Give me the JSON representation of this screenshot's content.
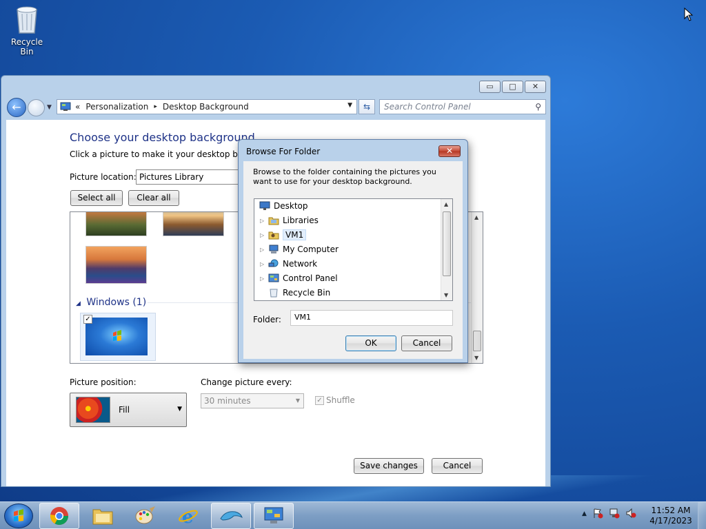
{
  "desktop": {
    "icons": [
      {
        "label": "Recycle Bin",
        "icon": "recycle-bin-icon"
      }
    ]
  },
  "window": {
    "caption_buttons": {
      "minimize": "▭",
      "maximize": "□",
      "close": "✕"
    },
    "address": {
      "prefix": "«",
      "crumbs": [
        "Personalization",
        "Desktop Background"
      ],
      "separator": "▸",
      "dropdown": "▼",
      "refresh": "⇆"
    },
    "search": {
      "placeholder": "Search Control Panel",
      "icon": "⚲"
    },
    "heading": "Choose your desktop background",
    "subheading": "Click a picture to make it your desktop background",
    "picture_location_label": "Picture location:",
    "picture_location_value": "Pictures Library",
    "select_all": "Select all",
    "clear_all": "Clear all",
    "group_expander": "◢",
    "group_title": "Windows (1)",
    "checkmark": "✓",
    "scroll_up": "▲",
    "scroll_down": "▼",
    "picture_position_label": "Picture position:",
    "picture_position_value": "Fill",
    "change_every_label": "Change picture every:",
    "change_every_value": "30 minutes",
    "shuffle_label": "Shuffle",
    "shuffle_checked": true,
    "save_changes": "Save changes",
    "cancel": "Cancel"
  },
  "dialog": {
    "title": "Browse For Folder",
    "close": "✕",
    "description": "Browse to the folder containing the pictures you want to use for your desktop background.",
    "tree": [
      {
        "label": "Desktop",
        "icon": "desktop-icon",
        "expander": false,
        "selected": false
      },
      {
        "label": "Libraries",
        "icon": "libraries-icon",
        "expander": true,
        "selected": false
      },
      {
        "label": "VM1",
        "icon": "user-folder-icon",
        "expander": true,
        "selected": true
      },
      {
        "label": "My Computer",
        "icon": "computer-icon",
        "expander": true,
        "selected": false
      },
      {
        "label": "Network",
        "icon": "network-icon",
        "expander": true,
        "selected": false
      },
      {
        "label": "Control Panel",
        "icon": "control-panel-icon",
        "expander": true,
        "selected": false
      },
      {
        "label": "Recycle Bin",
        "icon": "recycle-bin-icon",
        "expander": false,
        "selected": false
      }
    ],
    "expander_glyph": "▷",
    "folder_label": "Folder:",
    "folder_value": "VM1",
    "ok": "OK",
    "cancel": "Cancel"
  },
  "taskbar": {
    "apps": [
      {
        "name": "chrome",
        "icon": "chrome-icon",
        "active": true
      },
      {
        "name": "explorer",
        "icon": "folder-icon",
        "active": false
      },
      {
        "name": "paint",
        "icon": "palette-icon",
        "active": false
      },
      {
        "name": "internet-explorer",
        "icon": "ie-icon",
        "active": false
      },
      {
        "name": "dolphin",
        "icon": "dolphin-icon",
        "active": false
      },
      {
        "name": "control-panel",
        "icon": "control-panel-icon",
        "active": true
      }
    ],
    "tray_arrow": "▲",
    "clock_time": "11:52 AM",
    "clock_date": "4/17/2023"
  },
  "colors": {
    "heading_blue": "#1e3287",
    "window_frame": "#b9d1ea",
    "desktop_blue": "#1b5bb3"
  }
}
